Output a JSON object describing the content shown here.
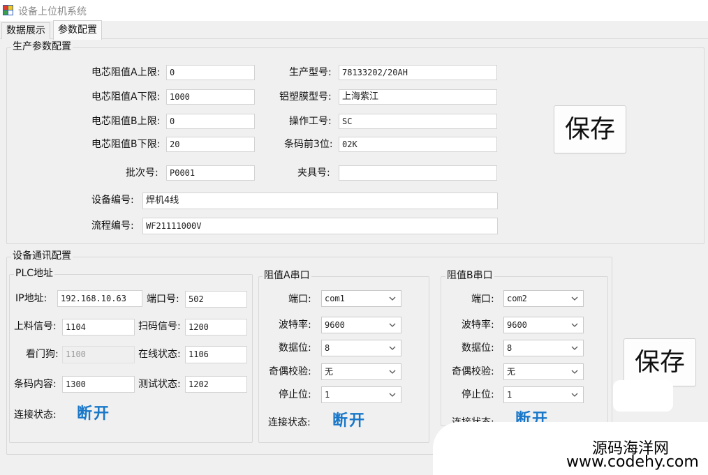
{
  "window": {
    "title": "设备上位机系统"
  },
  "tabs": [
    {
      "label": "数据展示"
    },
    {
      "label": "参数配置"
    }
  ],
  "production": {
    "group_title": "生产参数配置",
    "cell_res_a_upper": {
      "label": "电芯阻值A上限:",
      "value": "0"
    },
    "cell_res_a_lower": {
      "label": "电芯阻值A下限:",
      "value": "1000"
    },
    "cell_res_b_upper": {
      "label": "电芯阻值B上限:",
      "value": "0"
    },
    "cell_res_b_lower": {
      "label": "电芯阻值B下限:",
      "value": "20"
    },
    "batch_no": {
      "label": "批次号:",
      "value": "P0001"
    },
    "model": {
      "label": "生产型号:",
      "value": "78133202/20AH"
    },
    "film_model": {
      "label": "铝塑膜型号:",
      "value": "上海紫江"
    },
    "operator_id": {
      "label": "操作工号:",
      "value": "SC"
    },
    "barcode_prefix": {
      "label": "条码前3位:",
      "value": "02K"
    },
    "fixture_no": {
      "label": "夹具号:",
      "value": ""
    },
    "device_no": {
      "label": "设备编号:",
      "value": "焊机4线"
    },
    "process_no": {
      "label": "流程编号:",
      "value": "WF21111000V"
    },
    "save_label": "保存"
  },
  "comm": {
    "group_title": "设备通讯配置",
    "plc": {
      "title": "PLC地址",
      "ip": {
        "label": "IP地址:",
        "value": "192.168.10.63"
      },
      "port": {
        "label": "端口号:",
        "value": "502"
      },
      "feed_signal": {
        "label": "上料信号:",
        "value": "1104"
      },
      "scan_signal": {
        "label": "扫码信号:",
        "value": "1200"
      },
      "watchdog": {
        "label": "看门狗:",
        "value": "1100"
      },
      "online_status": {
        "label": "在线状态:",
        "value": "1106"
      },
      "barcode_content": {
        "label": "条码内容:",
        "value": "1300"
      },
      "test_status": {
        "label": "测试状态:",
        "value": "1202"
      },
      "conn_label": "连接状态:",
      "conn_value": "断开"
    },
    "serial_a": {
      "title": "阻值A串口",
      "port": {
        "label": "端口:",
        "value": "com1"
      },
      "baud": {
        "label": "波特率:",
        "value": "9600"
      },
      "data_bits": {
        "label": "数据位:",
        "value": "8"
      },
      "parity": {
        "label": "奇偶校验:",
        "value": "无"
      },
      "stop_bits": {
        "label": "停止位:",
        "value": "1"
      },
      "conn_label": "连接状态:",
      "conn_value": "断开"
    },
    "serial_b": {
      "title": "阻值B串口",
      "port": {
        "label": "端口:",
        "value": "com2"
      },
      "baud": {
        "label": "波特率:",
        "value": "9600"
      },
      "data_bits": {
        "label": "数据位:",
        "value": "8"
      },
      "parity": {
        "label": "奇偶校验:",
        "value": "无"
      },
      "stop_bits": {
        "label": "停止位:",
        "value": "1"
      },
      "conn_label": "连接状态:",
      "conn_value": "断开"
    },
    "save_label": "保存"
  },
  "watermark": {
    "text": "源码海洋网",
    "url": "www.codehy.com"
  },
  "icons": {
    "app": "app-window-icon",
    "dropdown": "chevron-down-icon"
  },
  "colors": {
    "status_blue": "#1877c9",
    "background": "#f0f0f0"
  }
}
